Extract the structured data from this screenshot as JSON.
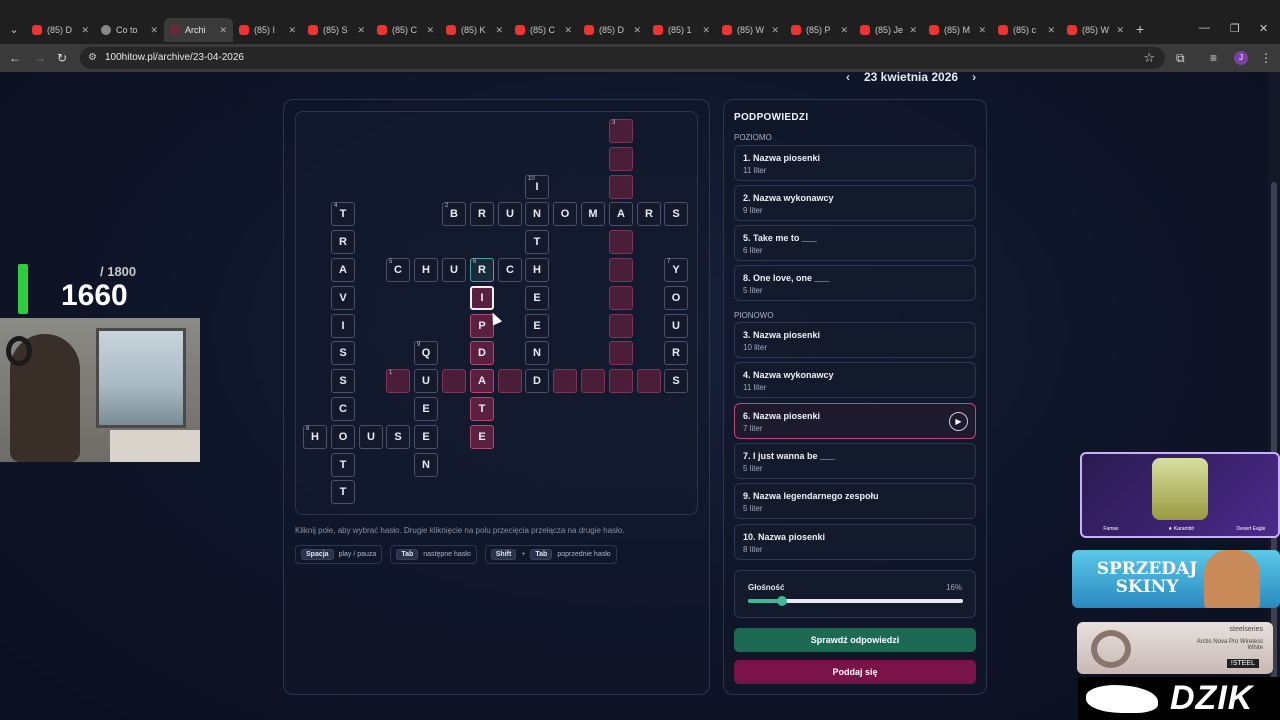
{
  "browser": {
    "tabs": [
      {
        "title": "(85) D",
        "icon": "youtube-icon"
      },
      {
        "title": "Co to",
        "icon": "web-icon"
      },
      {
        "title": "Archi",
        "icon": "site-icon",
        "active": true
      },
      {
        "title": "(85) I",
        "icon": "youtube-icon"
      },
      {
        "title": "(85) S",
        "icon": "youtube-icon"
      },
      {
        "title": "(85) C",
        "icon": "youtube-icon"
      },
      {
        "title": "(85) K",
        "icon": "youtube-icon"
      },
      {
        "title": "(85) C",
        "icon": "youtube-icon"
      },
      {
        "title": "(85) D",
        "icon": "youtube-icon"
      },
      {
        "title": "(85) 1",
        "icon": "youtube-icon"
      },
      {
        "title": "(85) W",
        "icon": "youtube-icon"
      },
      {
        "title": "(85) P",
        "icon": "youtube-icon"
      },
      {
        "title": "(85) Je",
        "icon": "youtube-icon"
      },
      {
        "title": "(85) M",
        "icon": "youtube-icon"
      },
      {
        "title": "(85) c",
        "icon": "youtube-icon"
      },
      {
        "title": "(85) W",
        "icon": "youtube-icon"
      }
    ],
    "url": "100hitow.pl/archive/23-04-2026",
    "profile_initial": "J"
  },
  "date_nav": {
    "date": "23 kwietnia 2026",
    "prev_icon": "chevron-left-icon",
    "next_icon": "chevron-right-icon"
  },
  "crossword": {
    "cells": [
      {
        "r": 0,
        "c": 11,
        "letter": "",
        "num": "3",
        "style": "pink"
      },
      {
        "r": 1,
        "c": 11,
        "letter": "",
        "style": "pink"
      },
      {
        "r": 2,
        "c": 8,
        "letter": "I",
        "num": "10"
      },
      {
        "r": 2,
        "c": 11,
        "letter": "",
        "style": "pink"
      },
      {
        "r": 3,
        "c": 1,
        "letter": "T",
        "num": "4"
      },
      {
        "r": 3,
        "c": 5,
        "letter": "B",
        "num": "2"
      },
      {
        "r": 3,
        "c": 6,
        "letter": "R"
      },
      {
        "r": 3,
        "c": 7,
        "letter": "U"
      },
      {
        "r": 3,
        "c": 8,
        "letter": "N"
      },
      {
        "r": 3,
        "c": 9,
        "letter": "O"
      },
      {
        "r": 3,
        "c": 10,
        "letter": "M"
      },
      {
        "r": 3,
        "c": 11,
        "letter": "A"
      },
      {
        "r": 3,
        "c": 12,
        "letter": "R"
      },
      {
        "r": 3,
        "c": 13,
        "letter": "S"
      },
      {
        "r": 4,
        "c": 1,
        "letter": "R"
      },
      {
        "r": 4,
        "c": 8,
        "letter": "T"
      },
      {
        "r": 4,
        "c": 11,
        "letter": "",
        "style": "pink"
      },
      {
        "r": 5,
        "c": 1,
        "letter": "A"
      },
      {
        "r": 5,
        "c": 3,
        "letter": "C",
        "num": "5"
      },
      {
        "r": 5,
        "c": 4,
        "letter": "H"
      },
      {
        "r": 5,
        "c": 5,
        "letter": "U"
      },
      {
        "r": 5,
        "c": 6,
        "letter": "R",
        "num": "6",
        "style": "teal"
      },
      {
        "r": 5,
        "c": 7,
        "letter": "C"
      },
      {
        "r": 5,
        "c": 8,
        "letter": "H"
      },
      {
        "r": 5,
        "c": 11,
        "letter": "",
        "style": "pink"
      },
      {
        "r": 5,
        "c": 13,
        "letter": "Y",
        "num": "7"
      },
      {
        "r": 6,
        "c": 1,
        "letter": "V"
      },
      {
        "r": 6,
        "c": 6,
        "letter": "I",
        "style": "sel"
      },
      {
        "r": 6,
        "c": 8,
        "letter": "E"
      },
      {
        "r": 6,
        "c": 11,
        "letter": "",
        "style": "pink"
      },
      {
        "r": 6,
        "c": 13,
        "letter": "O"
      },
      {
        "r": 7,
        "c": 1,
        "letter": "I"
      },
      {
        "r": 7,
        "c": 6,
        "letter": "P",
        "style": "hl"
      },
      {
        "r": 7,
        "c": 8,
        "letter": "E"
      },
      {
        "r": 7,
        "c": 11,
        "letter": "",
        "style": "pink"
      },
      {
        "r": 7,
        "c": 13,
        "letter": "U"
      },
      {
        "r": 8,
        "c": 1,
        "letter": "S"
      },
      {
        "r": 8,
        "c": 4,
        "letter": "Q",
        "num": "9"
      },
      {
        "r": 8,
        "c": 6,
        "letter": "D",
        "style": "hl"
      },
      {
        "r": 8,
        "c": 8,
        "letter": "N"
      },
      {
        "r": 8,
        "c": 11,
        "letter": "",
        "style": "pink"
      },
      {
        "r": 8,
        "c": 13,
        "letter": "R"
      },
      {
        "r": 9,
        "c": 1,
        "letter": "S"
      },
      {
        "r": 9,
        "c": 3,
        "letter": "",
        "num": "1",
        "style": "pink"
      },
      {
        "r": 9,
        "c": 4,
        "letter": "U"
      },
      {
        "r": 9,
        "c": 5,
        "letter": "",
        "style": "pink"
      },
      {
        "r": 9,
        "c": 6,
        "letter": "A",
        "style": "hl"
      },
      {
        "r": 9,
        "c": 7,
        "letter": "",
        "style": "pink"
      },
      {
        "r": 9,
        "c": 8,
        "letter": "D"
      },
      {
        "r": 9,
        "c": 9,
        "letter": "",
        "style": "pink"
      },
      {
        "r": 9,
        "c": 10,
        "letter": "",
        "style": "pink"
      },
      {
        "r": 9,
        "c": 11,
        "letter": "",
        "style": "pink"
      },
      {
        "r": 9,
        "c": 12,
        "letter": "",
        "style": "pink"
      },
      {
        "r": 9,
        "c": 13,
        "letter": "S"
      },
      {
        "r": 10,
        "c": 1,
        "letter": "C"
      },
      {
        "r": 10,
        "c": 4,
        "letter": "E"
      },
      {
        "r": 10,
        "c": 6,
        "letter": "T",
        "style": "hl"
      },
      {
        "r": 11,
        "c": 0,
        "letter": "H",
        "num": "8"
      },
      {
        "r": 11,
        "c": 1,
        "letter": "O"
      },
      {
        "r": 11,
        "c": 2,
        "letter": "U"
      },
      {
        "r": 11,
        "c": 3,
        "letter": "S"
      },
      {
        "r": 11,
        "c": 4,
        "letter": "E"
      },
      {
        "r": 11,
        "c": 6,
        "letter": "E",
        "style": "hl"
      },
      {
        "r": 12,
        "c": 1,
        "letter": "T"
      },
      {
        "r": 12,
        "c": 4,
        "letter": "N"
      },
      {
        "r": 13,
        "c": 1,
        "letter": "T"
      }
    ],
    "instruction": "Kliknij pole, aby wybrać hasło. Drugie kliknięcie na polu przecięcia przełącza na drugie hasło.",
    "shortcuts": {
      "space_key": "Spacja",
      "space_desc": "play / pauza",
      "tab_key": "Tab",
      "tab_desc": "następne hasło",
      "shift_key": "Shift",
      "plus": "+",
      "shift_tab_key": "Tab",
      "shift_tab_desc": "poprzednie hasło"
    }
  },
  "hints": {
    "title": "PODPOWIEDZI",
    "horizontal_label": "POZIOMO",
    "vertical_label": "PIONOWO",
    "horizontal": [
      {
        "title": "1. Nazwa piosenki",
        "sub": "11 liter"
      },
      {
        "title": "2. Nazwa wykonawcy",
        "sub": "9 liter"
      },
      {
        "title": "5. Take me to ___",
        "sub": "6 liter"
      },
      {
        "title": "8. One love, one ___",
        "sub": "5 liter"
      }
    ],
    "vertical": [
      {
        "title": "3. Nazwa piosenki",
        "sub": "10 liter"
      },
      {
        "title": "4. Nazwa wykonawcy",
        "sub": "11 liter"
      },
      {
        "title": "6. Nazwa piosenki",
        "sub": "7 liter",
        "active": true
      },
      {
        "title": "7. I just wanna be ___",
        "sub": "5 liter"
      },
      {
        "title": "9. Nazwa legendarnego zespołu",
        "sub": "5 liter"
      },
      {
        "title": "10. Nazwa piosenki",
        "sub": "8 liter"
      }
    ],
    "volume_label": "Głośność",
    "volume_percent": "16%",
    "volume_value": 0.16,
    "check_button": "Sprawdź odpowiedzi",
    "give_up_button": "Poddaj się"
  },
  "overlay": {
    "score_max": "/ 1800",
    "score_current": "1660",
    "ad1_items": [
      "Famas",
      "★ Karambit",
      "Desert Eagle"
    ],
    "ad2_text": "SPRZEDAJ SKINY",
    "ad3_brand": "steelseries",
    "ad3_product": "Arctis Nova Pro Wireless White",
    "ad3_code": "!STEEL",
    "dzik_text": "DZIK"
  }
}
